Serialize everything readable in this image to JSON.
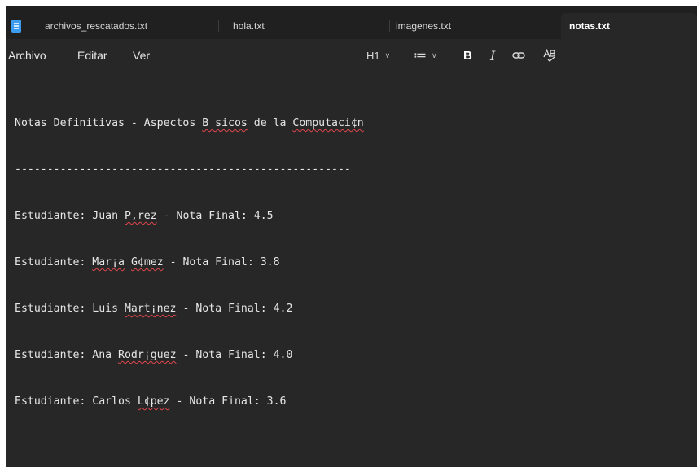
{
  "tabs": [
    {
      "label": "archivos_rescatados.txt",
      "active": false
    },
    {
      "label": "hola.txt",
      "active": false
    },
    {
      "label": "imagenes.txt",
      "active": false
    },
    {
      "label": "notas.txt",
      "active": true
    }
  ],
  "menu": {
    "file": "Archivo",
    "edit": "Editar",
    "view": "Ver"
  },
  "toolbar": {
    "heading": "H1",
    "list_icon": "≔",
    "bold": "B",
    "italic": "I",
    "link_icon": "link-icon",
    "spellcheck_icon": "spellcheck-icon"
  },
  "document": {
    "title": [
      "Notas Definitivas - Aspectos ",
      "B sicos",
      " de la ",
      "Computaci¢n"
    ],
    "divider": "----------------------------------------------------",
    "lines": [
      [
        "Estudiante: Juan ",
        "P‚rez",
        " - Nota Final: 4.5"
      ],
      [
        "Estudiante: ",
        "Mar¡a",
        " ",
        "G¢mez",
        " - Nota Final: 3.8"
      ],
      [
        "Estudiante: Luis ",
        "Mart¡nez",
        " - Nota Final: 4.2"
      ],
      [
        "Estudiante: Ana ",
        "Rodr¡guez",
        " - Nota Final: 4.0"
      ],
      [
        "Estudiante: Carlos ",
        "L¢pez",
        " - Nota Final: 3.6"
      ]
    ]
  },
  "colors": {
    "background": "#272727",
    "tabbar": "#202020",
    "text": "#e6e6e6",
    "spellcheck_underline": "#e0474c",
    "file_icon": "#3b9cf0"
  }
}
